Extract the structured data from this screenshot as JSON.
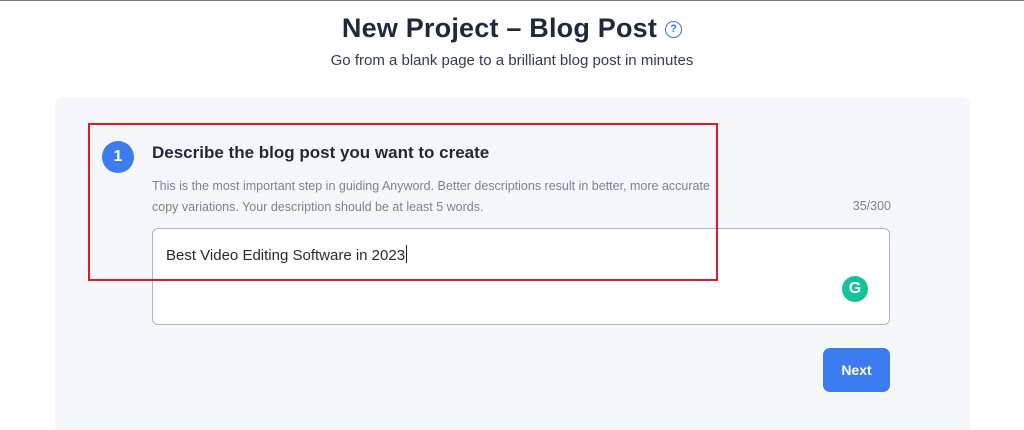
{
  "header": {
    "title": "New Project – Blog Post",
    "help_icon": "question-circle-icon",
    "help_glyph": "?",
    "subtitle": "Go from a blank page to a brilliant blog post in minutes"
  },
  "step": {
    "number": "1",
    "heading": "Describe the blog post you want to create",
    "description": "This is the most important step in guiding Anyword. Better descriptions result in better, more accurate copy variations. Your description should be at least 5 words.",
    "counter": "35/300",
    "input_value": "Best Video Editing Software in 2023",
    "grammarly_icon": "grammarly-icon",
    "grammarly_glyph": "G"
  },
  "actions": {
    "next_label": "Next"
  },
  "colors": {
    "accent": "#3d7bf0",
    "highlight": "#e01b22",
    "grammarly": "#15c39a",
    "card_background": "#f6f7fb"
  }
}
